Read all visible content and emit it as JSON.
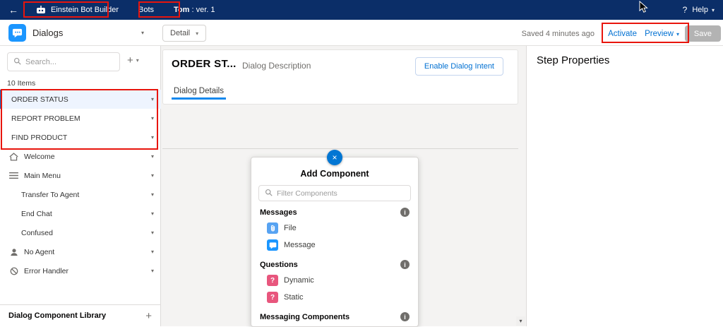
{
  "colors": {
    "header_navy": "#0b2e68",
    "accent_blue": "#0070d2",
    "icon_blue": "#1b96ff",
    "icon_file_blue": "#57a3f2",
    "question_pink": "#e8567d",
    "tab_underline_blue": "#1589ee",
    "annotation_red": "#e8150d"
  },
  "icons": {
    "back_arrow": "←",
    "chevron_down": "▾",
    "plus": "+",
    "info_glyph": "i",
    "close_glyph": "×",
    "help_glyph": "?",
    "question_glyph": "?"
  },
  "top_nav": {
    "app_name": "Einstein Bot Builder",
    "bots_label": "Bots",
    "bot_name": "Tom",
    "bot_version": " : ver. 1",
    "help_label": "Help"
  },
  "toolbar": {
    "entity_label": "Dialogs",
    "detail_label": "Detail",
    "saved_status": "Saved 4 minutes ago",
    "activate_label": "Activate",
    "preview_label": "Preview",
    "save_label": "Save"
  },
  "sidebar": {
    "search_placeholder": "Search...",
    "items_count": "10 Items",
    "items": [
      {
        "label": "ORDER STATUS",
        "selected": true
      },
      {
        "label": "REPORT PROBLEM"
      },
      {
        "label": "FIND PRODUCT"
      },
      {
        "label": "Welcome",
        "icon": "home"
      },
      {
        "label": "Main Menu",
        "icon": "menu"
      },
      {
        "label": "Transfer To Agent"
      },
      {
        "label": "End Chat"
      },
      {
        "label": "Confused"
      },
      {
        "label": "No Agent",
        "icon": "person"
      },
      {
        "label": "Error Handler",
        "icon": "ban"
      }
    ],
    "footer_label": "Dialog Component Library"
  },
  "main": {
    "dialog_title": "ORDER ST...",
    "dialog_description": "Dialog Description",
    "enable_intent_label": "Enable Dialog Intent",
    "tab_label": "Dialog Details",
    "add_component": {
      "title": "Add Component",
      "filter_placeholder": "Filter Components",
      "sections": [
        {
          "label": "Messages",
          "items": [
            {
              "label": "File",
              "icon": "paperclip"
            },
            {
              "label": "Message",
              "icon": "chat"
            }
          ]
        },
        {
          "label": "Questions",
          "items": [
            {
              "label": "Dynamic",
              "icon": "question"
            },
            {
              "label": "Static",
              "icon": "question"
            }
          ]
        },
        {
          "label": "Messaging Components",
          "items": []
        }
      ]
    }
  },
  "right_panel": {
    "title": "Step Properties"
  }
}
